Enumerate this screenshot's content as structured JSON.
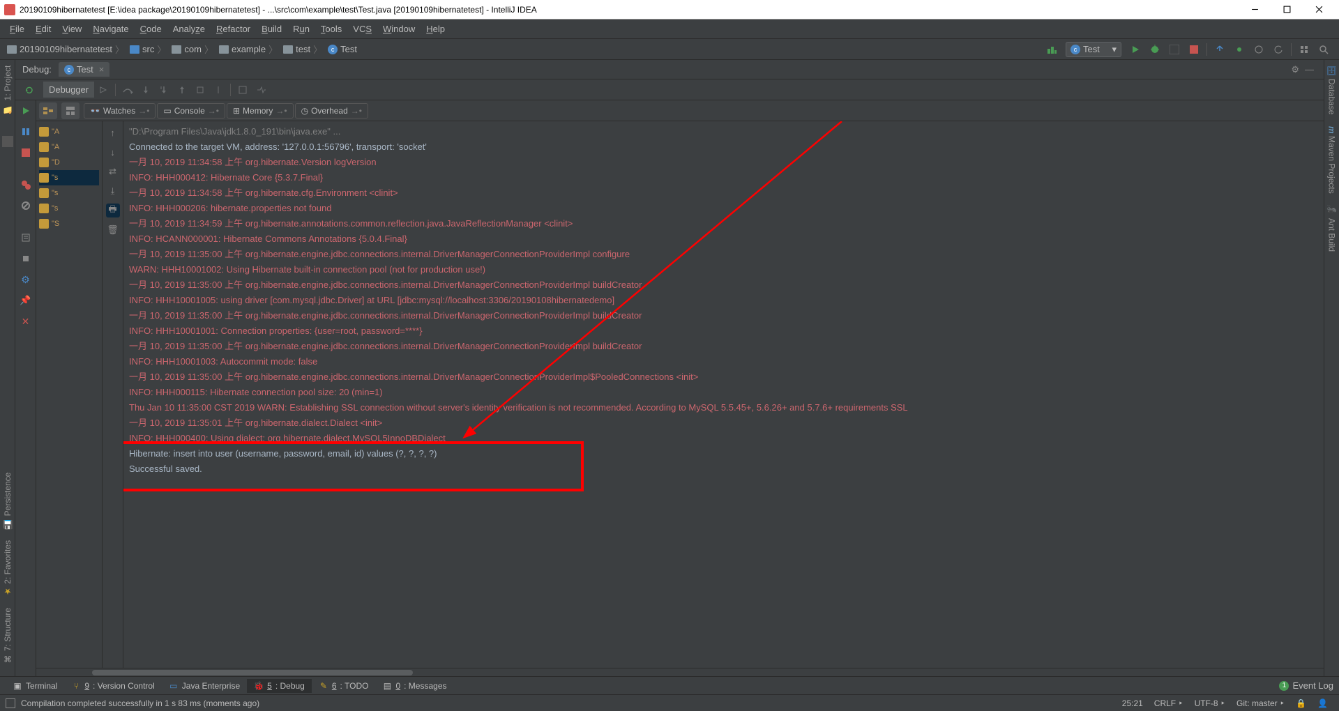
{
  "titlebar": {
    "title": "20190109hibernatetest [E:\\idea package\\20190109hibernatetest] - ...\\src\\com\\example\\test\\Test.java [20190109hibernatetest] - IntelliJ IDEA"
  },
  "menu": {
    "file": "File",
    "edit": "Edit",
    "view": "View",
    "navigate": "Navigate",
    "code": "Code",
    "analyze": "Analyze",
    "refactor": "Refactor",
    "build": "Build",
    "run": "Run",
    "tools": "Tools",
    "vcs": "VCS",
    "window": "Window",
    "help": "Help"
  },
  "breadcrumb": {
    "root": "20190109hibernatetest",
    "p1": "src",
    "p2": "com",
    "p3": "example",
    "p4": "test",
    "p5": "Test"
  },
  "run_config": {
    "name": "Test"
  },
  "left_tools": {
    "project": "1: Project",
    "persistence": "Persistence",
    "favorites": "2: Favorites",
    "structure": "7: Structure"
  },
  "right_tools": {
    "database": "Database",
    "maven": "Maven Projects",
    "ant": "Ant Build"
  },
  "debug": {
    "label": "Debug:",
    "tab_name": "Test",
    "debugger_label": "Debugger",
    "tabs": {
      "watches": "Watches",
      "console": "Console",
      "memory": "Memory",
      "overhead": "Overhead"
    },
    "frames": [
      "\"A",
      "\"A",
      "\"D",
      "\"s",
      "\"s",
      "\"s",
      "\"S"
    ]
  },
  "console_lines": [
    {
      "cls": "gray",
      "text": "\"D:\\Program Files\\Java\\jdk1.8.0_191\\bin\\java.exe\" ..."
    },
    {
      "cls": "normal",
      "text": "Connected to the target VM, address: '127.0.0.1:56796', transport: 'socket'"
    },
    {
      "cls": "red",
      "text": "一月 10, 2019 11:34:58 上午 org.hibernate.Version logVersion"
    },
    {
      "cls": "red",
      "text": "INFO: HHH000412: Hibernate Core {5.3.7.Final}"
    },
    {
      "cls": "red",
      "text": "一月 10, 2019 11:34:58 上午 org.hibernate.cfg.Environment <clinit>"
    },
    {
      "cls": "red",
      "text": "INFO: HHH000206: hibernate.properties not found"
    },
    {
      "cls": "red",
      "text": "一月 10, 2019 11:34:59 上午 org.hibernate.annotations.common.reflection.java.JavaReflectionManager <clinit>"
    },
    {
      "cls": "red",
      "text": "INFO: HCANN000001: Hibernate Commons Annotations {5.0.4.Final}"
    },
    {
      "cls": "red",
      "text": "一月 10, 2019 11:35:00 上午 org.hibernate.engine.jdbc.connections.internal.DriverManagerConnectionProviderImpl configure"
    },
    {
      "cls": "red",
      "text": "WARN: HHH10001002: Using Hibernate built-in connection pool (not for production use!)"
    },
    {
      "cls": "red",
      "text": "一月 10, 2019 11:35:00 上午 org.hibernate.engine.jdbc.connections.internal.DriverManagerConnectionProviderImpl buildCreator"
    },
    {
      "cls": "red",
      "text": "INFO: HHH10001005: using driver [com.mysql.jdbc.Driver] at URL [jdbc:mysql://localhost:3306/20190108hibernatedemo]"
    },
    {
      "cls": "red",
      "text": "一月 10, 2019 11:35:00 上午 org.hibernate.engine.jdbc.connections.internal.DriverManagerConnectionProviderImpl buildCreator"
    },
    {
      "cls": "red",
      "text": "INFO: HHH10001001: Connection properties: {user=root, password=****}"
    },
    {
      "cls": "red",
      "text": "一月 10, 2019 11:35:00 上午 org.hibernate.engine.jdbc.connections.internal.DriverManagerConnectionProviderImpl buildCreator"
    },
    {
      "cls": "red",
      "text": "INFO: HHH10001003: Autocommit mode: false"
    },
    {
      "cls": "red",
      "text": "一月 10, 2019 11:35:00 上午 org.hibernate.engine.jdbc.connections.internal.DriverManagerConnectionProviderImpl$PooledConnections <init>"
    },
    {
      "cls": "red",
      "text": "INFO: HHH000115: Hibernate connection pool size: 20 (min=1)"
    },
    {
      "cls": "red",
      "text": "Thu Jan 10 11:35:00 CST 2019 WARN: Establishing SSL connection without server's identity verification is not recommended. According to MySQL 5.5.45+, 5.6.26+ and 5.7.6+ requirements SSL"
    },
    {
      "cls": "red",
      "text": "一月 10, 2019 11:35:01 上午 org.hibernate.dialect.Dialect <init>"
    },
    {
      "cls": "red",
      "text": "INFO: HHH000400: Using dialect: org.hibernate.dialect.MySQL5InnoDBDialect"
    },
    {
      "cls": "normal",
      "text": "Hibernate: insert into user (username, password, email, id) values (?, ?, ?, ?)"
    },
    {
      "cls": "normal",
      "text": "Successful saved."
    }
  ],
  "bottom": {
    "terminal": "Terminal",
    "version_control": "9: Version Control",
    "java_ee": "Java Enterprise",
    "debug": "5: Debug",
    "todo": "6: TODO",
    "messages": "0: Messages",
    "event_log": "Event Log",
    "event_count": "1"
  },
  "status": {
    "msg": "Compilation completed successfully in 1 s 83 ms (moments ago)",
    "cursor": "25:21",
    "line_sep": "CRLF",
    "encoding": "UTF-8",
    "git": "Git: master"
  }
}
